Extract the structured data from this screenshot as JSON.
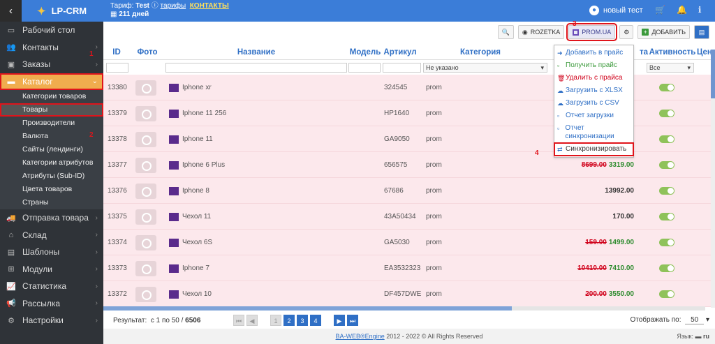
{
  "topbar": {
    "back_icon": "chevron-left-icon",
    "app_name": "LP-CRM",
    "tariff_label": "Тариф:",
    "tariff_name": "Test",
    "tariffs_link": "тарифы",
    "contacts_link": "КОНТАКТЫ",
    "days_left": "211 дней",
    "user_name": "новый тест"
  },
  "sidebar": {
    "items": [
      {
        "label": "Рабочий стол",
        "icon": "desktop-icon"
      },
      {
        "label": "Контакты",
        "icon": "users-icon"
      },
      {
        "label": "Заказы",
        "icon": "money-icon"
      },
      {
        "label": "Каталог",
        "icon": "inbox-icon"
      },
      {
        "label": "Отправка товара",
        "icon": "truck-icon"
      },
      {
        "label": "Склад",
        "icon": "warehouse-icon"
      },
      {
        "label": "Шаблоны",
        "icon": "file-icon"
      },
      {
        "label": "Модули",
        "icon": "sitemap-icon"
      },
      {
        "label": "Статистика",
        "icon": "chart-icon"
      },
      {
        "label": "Рассылка",
        "icon": "bullhorn-icon"
      },
      {
        "label": "Настройки",
        "icon": "gear-icon"
      }
    ],
    "submenu": [
      "Категории товаров",
      "Товары",
      "Производители",
      "Валюта",
      "Сайты (лендинги)",
      "Категории атрибутов",
      "Атрибуты (Sub-ID)",
      "Цвета товаров",
      "Страны"
    ],
    "annotations": {
      "a1": "1",
      "a2": "2"
    }
  },
  "toolbar": {
    "rozetka_label": "ROZETKA",
    "prom_label": "PROM.UA",
    "add_label": "ДОБАВИТЬ",
    "annotation": "3"
  },
  "grid": {
    "headers": {
      "id": "ID",
      "photo": "Фото",
      "name": "Название",
      "model": "Модель",
      "sku": "Артикул",
      "category": "Категория",
      "sta": "та",
      "active": "Активность",
      "price": "Цена"
    },
    "category_filter": "Не указано",
    "active_filter": "Все",
    "rows": [
      {
        "id": "13380",
        "name": "Iphone xr",
        "sku": "324545",
        "cat": "prom",
        "old": "",
        "new": ""
      },
      {
        "id": "13379",
        "name": "Iphone 11 256",
        "sku": "HP1640",
        "cat": "prom",
        "old": "",
        "new": ""
      },
      {
        "id": "13378",
        "name": "Iphone 11",
        "sku": "GA9050",
        "cat": "prom",
        "old": "",
        "new": ""
      },
      {
        "id": "13377",
        "name": "Iphone 6 Plus",
        "sku": "656575",
        "cat": "prom",
        "old": "8699.00",
        "new": "3319.00"
      },
      {
        "id": "13376",
        "name": "Iphone 8",
        "sku": "67686",
        "cat": "prom",
        "old": "",
        "new": "13992.00"
      },
      {
        "id": "13375",
        "name": "Чехол 11",
        "sku": "43A50434",
        "cat": "prom",
        "old": "",
        "new": "170.00"
      },
      {
        "id": "13374",
        "name": "Чехол 6S",
        "sku": "GA5030",
        "cat": "prom",
        "old": "159.00",
        "new": "1499.00"
      },
      {
        "id": "13373",
        "name": "Iphone 7",
        "sku": "EA3532323",
        "cat": "prom",
        "old": "10410.00",
        "new": "7410.00"
      },
      {
        "id": "13372",
        "name": "Чехол 10",
        "sku": "DF457DWE",
        "cat": "prom",
        "old": "200.00",
        "new": "3550.00"
      }
    ]
  },
  "dropdown": {
    "items": [
      {
        "label": "Добавить в прайс",
        "icon": "sign-in-icon"
      },
      {
        "label": "Получить прайс",
        "icon": "file-icon"
      },
      {
        "label": "Удалить с прайса",
        "icon": "trash-icon"
      },
      {
        "label": "Загрузить с XLSX",
        "icon": "cloud-upload-icon"
      },
      {
        "label": "Загрузить с CSV",
        "icon": "cloud-upload-icon"
      },
      {
        "label": "Отчет загрузки",
        "icon": "file-icon"
      },
      {
        "label": "Отчет синхронизации",
        "icon": "file-icon"
      },
      {
        "label": "Синхронизировать",
        "icon": "shuffle-icon"
      }
    ],
    "annotation": "4"
  },
  "footer": {
    "result_label": "Результат:",
    "result_range": "с 1 по 50 /",
    "result_total": "6506",
    "pages": [
      "1",
      "2",
      "3",
      "4"
    ],
    "perpage_label": "Отображать по:",
    "perpage_value": "50",
    "copyright_link": "BA-WEB®Engine",
    "copyright_text": "2012 - 2022 © All Rights Reserved",
    "lang_label": "Язык:",
    "lang_value": "ru"
  },
  "colors": {
    "accent": "#3b7dd8",
    "sidebar": "#2f3338",
    "active_menu": "#f0ad4e",
    "row_bg": "#fce8ec",
    "annotation": "#e0141b"
  }
}
